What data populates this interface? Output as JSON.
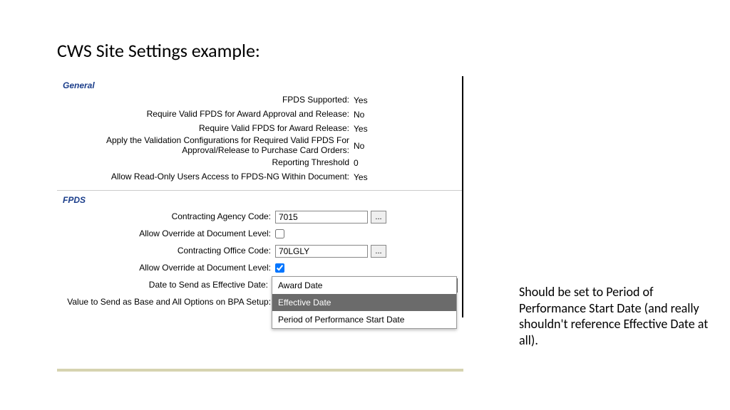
{
  "page_title": "CWS Site Settings example:",
  "general": {
    "section_title": "General",
    "rows": [
      {
        "label": "FPDS Supported:",
        "value": "Yes"
      },
      {
        "label": "Require Valid FPDS for Award Approval and Release:",
        "value": "No"
      },
      {
        "label": "Require Valid FPDS for Award Release:",
        "value": "Yes"
      },
      {
        "label": "Apply the Validation Configurations for Required Valid FPDS For Approval/Release to Purchase Card Orders:",
        "value": "No"
      },
      {
        "label": "Reporting Threshold",
        "value": "0"
      },
      {
        "label": "Allow Read-Only Users Access to FPDS-NG Within Document:",
        "value": "Yes"
      }
    ]
  },
  "fpds": {
    "section_title": "FPDS",
    "contracting_agency_code_label": "Contracting Agency Code:",
    "contracting_agency_code_value": "7015",
    "allow_override_1_label": "Allow Override at Document Level:",
    "allow_override_1_checked": false,
    "contracting_office_code_label": "Contracting Office Code:",
    "contracting_office_code_value": "70LGLY",
    "allow_override_2_label": "Allow Override at Document Level:",
    "allow_override_2_checked": true,
    "date_to_send_label": "Date to Send as Effective Date:",
    "date_to_send_value": "Effective Date",
    "value_bpa_label": "Value to Send as Base and All Options on BPA Setup:",
    "lookup_button": "...",
    "dropdown_options": [
      "Award Date",
      "Effective Date",
      "Period of Performance Start Date"
    ],
    "dropdown_selected_index": 1
  },
  "annotation": "Should be set to Period of Performance Start Date (and really shouldn't reference Effective Date at all)."
}
